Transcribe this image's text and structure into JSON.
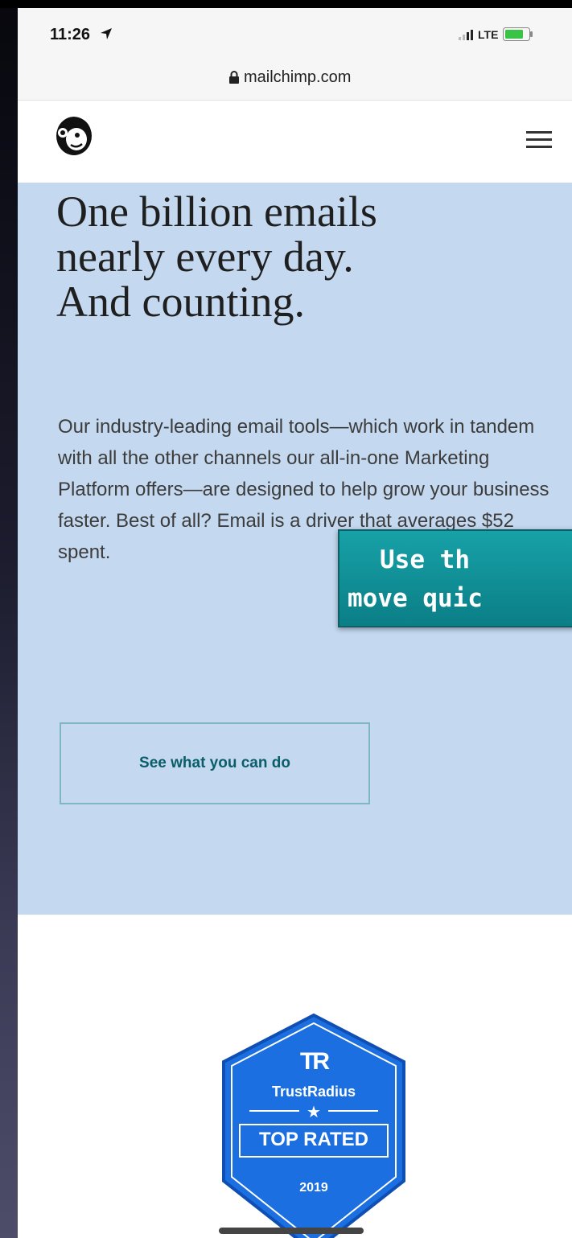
{
  "status_bar": {
    "time": "11:26",
    "network": "LTE"
  },
  "address_bar": {
    "url": "mailchimp.com"
  },
  "hero": {
    "title_lines": [
      "One billion emails",
      "nearly every day.",
      "And counting."
    ],
    "description": "Our industry-leading email tools—which work in tandem with all the other channels our all-in-one Marketing Platform offers—are designed to help grow your business faster. Best of all? Email is a driver that averages $52 spent.",
    "cta_label": "See what you can do",
    "background_color": "#c4d8ef"
  },
  "overlay": {
    "line1": "Use th",
    "line2": "move quic"
  },
  "badge": {
    "logo": "TR",
    "name": "TrustRadius",
    "star": "★",
    "label": "TOP RATED",
    "year": "2019",
    "color": "#1b6fe0"
  }
}
